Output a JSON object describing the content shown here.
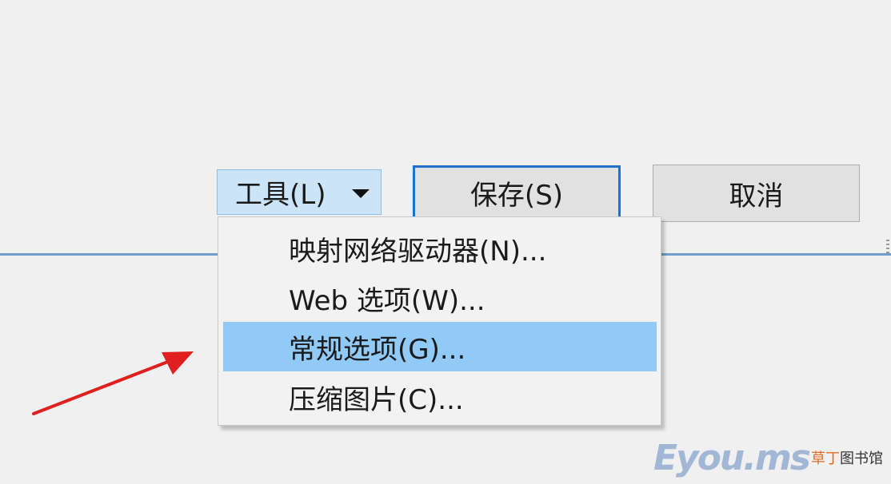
{
  "toolbar": {
    "tools_label": "工具(L)",
    "save_label": "保存(S)",
    "cancel_label": "取消"
  },
  "menu": {
    "items": [
      {
        "label": "映射网络驱动器(N)...",
        "highlighted": false
      },
      {
        "label": "Web 选项(W)...",
        "highlighted": false
      },
      {
        "label": "常规选项(G)...",
        "highlighted": true
      },
      {
        "label": "压缩图片(C)...",
        "highlighted": false
      }
    ]
  },
  "watermark": {
    "logo": "Eyou.ms",
    "accent_text": "草丁",
    "text": "图书馆"
  },
  "colors": {
    "background": "#f0f0f0",
    "tools_button": "#cce4f7",
    "save_border": "#1f72c6",
    "highlight": "#91c9f7",
    "annotation_arrow": "#e02020",
    "watermark_accent": "#e36b1d"
  },
  "icons": {
    "dropdown": "chevron-down-icon",
    "annotation": "red-arrow-icon"
  }
}
